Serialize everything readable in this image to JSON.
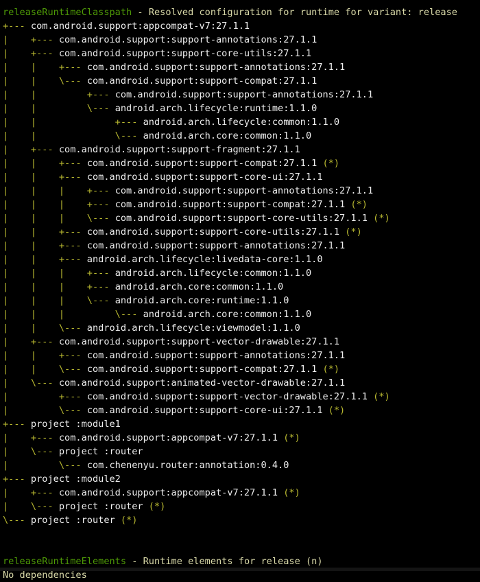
{
  "terminal": {
    "background_color": "#000000",
    "config_name_color": "#4e9a06",
    "description_color": "#d9d9a8",
    "tree_color": "#b8b830",
    "coordinate_color": "#eeeeee"
  },
  "lines": [
    {
      "type": "header",
      "config": "releaseRuntimeClasspath",
      "sep": " - ",
      "desc": "Resolved configuration for runtime for variant: release"
    },
    {
      "type": "dep",
      "tree": "+--- ",
      "coord": "com.android.support:appcompat-v7:27.1.1",
      "star": ""
    },
    {
      "type": "dep",
      "tree": "|    +--- ",
      "coord": "com.android.support:support-annotations:27.1.1",
      "star": ""
    },
    {
      "type": "dep",
      "tree": "|    +--- ",
      "coord": "com.android.support:support-core-utils:27.1.1",
      "star": ""
    },
    {
      "type": "dep",
      "tree": "|    |    +--- ",
      "coord": "com.android.support:support-annotations:27.1.1",
      "star": ""
    },
    {
      "type": "dep",
      "tree": "|    |    \\--- ",
      "coord": "com.android.support:support-compat:27.1.1",
      "star": ""
    },
    {
      "type": "dep",
      "tree": "|    |         +--- ",
      "coord": "com.android.support:support-annotations:27.1.1",
      "star": ""
    },
    {
      "type": "dep",
      "tree": "|    |         \\--- ",
      "coord": "android.arch.lifecycle:runtime:1.1.0",
      "star": ""
    },
    {
      "type": "dep",
      "tree": "|    |              +--- ",
      "coord": "android.arch.lifecycle:common:1.1.0",
      "star": ""
    },
    {
      "type": "dep",
      "tree": "|    |              \\--- ",
      "coord": "android.arch.core:common:1.1.0",
      "star": ""
    },
    {
      "type": "dep",
      "tree": "|    +--- ",
      "coord": "com.android.support:support-fragment:27.1.1",
      "star": ""
    },
    {
      "type": "dep",
      "tree": "|    |    +--- ",
      "coord": "com.android.support:support-compat:27.1.1",
      "star": " (*)"
    },
    {
      "type": "dep",
      "tree": "|    |    +--- ",
      "coord": "com.android.support:support-core-ui:27.1.1",
      "star": ""
    },
    {
      "type": "dep",
      "tree": "|    |    |    +--- ",
      "coord": "com.android.support:support-annotations:27.1.1",
      "star": ""
    },
    {
      "type": "dep",
      "tree": "|    |    |    +--- ",
      "coord": "com.android.support:support-compat:27.1.1",
      "star": " (*)"
    },
    {
      "type": "dep",
      "tree": "|    |    |    \\--- ",
      "coord": "com.android.support:support-core-utils:27.1.1",
      "star": " (*)"
    },
    {
      "type": "dep",
      "tree": "|    |    +--- ",
      "coord": "com.android.support:support-core-utils:27.1.1",
      "star": " (*)"
    },
    {
      "type": "dep",
      "tree": "|    |    +--- ",
      "coord": "com.android.support:support-annotations:27.1.1",
      "star": ""
    },
    {
      "type": "dep",
      "tree": "|    |    +--- ",
      "coord": "android.arch.lifecycle:livedata-core:1.1.0",
      "star": ""
    },
    {
      "type": "dep",
      "tree": "|    |    |    +--- ",
      "coord": "android.arch.lifecycle:common:1.1.0",
      "star": ""
    },
    {
      "type": "dep",
      "tree": "|    |    |    +--- ",
      "coord": "android.arch.core:common:1.1.0",
      "star": ""
    },
    {
      "type": "dep",
      "tree": "|    |    |    \\--- ",
      "coord": "android.arch.core:runtime:1.1.0",
      "star": ""
    },
    {
      "type": "dep",
      "tree": "|    |    |         \\--- ",
      "coord": "android.arch.core:common:1.1.0",
      "star": ""
    },
    {
      "type": "dep",
      "tree": "|    |    \\--- ",
      "coord": "android.arch.lifecycle:viewmodel:1.1.0",
      "star": ""
    },
    {
      "type": "dep",
      "tree": "|    +--- ",
      "coord": "com.android.support:support-vector-drawable:27.1.1",
      "star": ""
    },
    {
      "type": "dep",
      "tree": "|    |    +--- ",
      "coord": "com.android.support:support-annotations:27.1.1",
      "star": ""
    },
    {
      "type": "dep",
      "tree": "|    |    \\--- ",
      "coord": "com.android.support:support-compat:27.1.1",
      "star": " (*)"
    },
    {
      "type": "dep",
      "tree": "|    \\--- ",
      "coord": "com.android.support:animated-vector-drawable:27.1.1",
      "star": ""
    },
    {
      "type": "dep",
      "tree": "|         +--- ",
      "coord": "com.android.support:support-vector-drawable:27.1.1",
      "star": " (*)"
    },
    {
      "type": "dep",
      "tree": "|         \\--- ",
      "coord": "com.android.support:support-core-ui:27.1.1",
      "star": " (*)"
    },
    {
      "type": "dep",
      "tree": "+--- ",
      "coord": "project :module1",
      "star": ""
    },
    {
      "type": "dep",
      "tree": "|    +--- ",
      "coord": "com.android.support:appcompat-v7:27.1.1",
      "star": " (*)"
    },
    {
      "type": "dep",
      "tree": "|    \\--- ",
      "coord": "project :router",
      "star": ""
    },
    {
      "type": "dep",
      "tree": "|         \\--- ",
      "coord": "com.chenenyu.router:annotation:0.4.0",
      "star": ""
    },
    {
      "type": "dep",
      "tree": "+--- ",
      "coord": "project :module2",
      "star": ""
    },
    {
      "type": "dep",
      "tree": "|    +--- ",
      "coord": "com.android.support:appcompat-v7:27.1.1",
      "star": " (*)"
    },
    {
      "type": "dep",
      "tree": "|    \\--- ",
      "coord": "project :router",
      "star": " (*)"
    },
    {
      "type": "dep",
      "tree": "\\--- ",
      "coord": "project :router",
      "star": " (*)"
    },
    {
      "type": "blank",
      "text": ""
    },
    {
      "type": "blank",
      "text": ""
    },
    {
      "type": "header",
      "config": "releaseRuntimeElements",
      "sep": " - ",
      "desc": "Runtime elements for release (n)"
    },
    {
      "type": "info",
      "text": "No dependencies"
    }
  ]
}
